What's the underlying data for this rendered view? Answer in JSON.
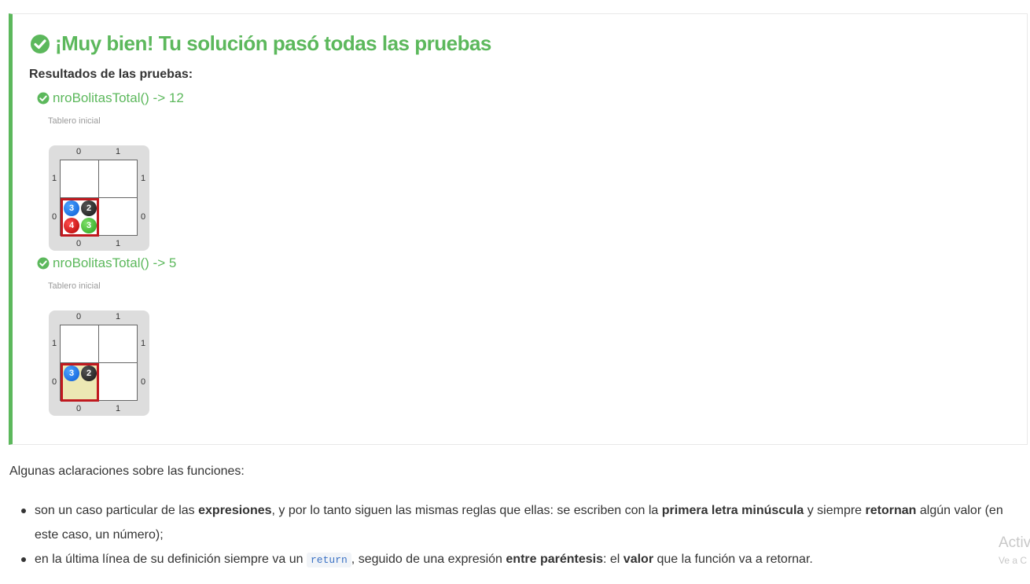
{
  "result": {
    "title": "¡Muy bien! Tu solución pasó todas las pruebas",
    "results_label": "Resultados de las pruebas:",
    "accent_color": "#5cb85c",
    "icon": "check-circle-icon",
    "tests": [
      {
        "title": "nroBolitasTotal() -> 12",
        "caption": "Tablero inicial",
        "board": {
          "columns": [
            "0",
            "1"
          ],
          "rows": [
            "1",
            "0"
          ],
          "head_cell": {
            "row": "0",
            "col": "0"
          },
          "balls": [
            "3",
            "2",
            "4",
            "3"
          ]
        }
      },
      {
        "title": "nroBolitasTotal() -> 5",
        "caption": "Tablero inicial",
        "board": {
          "columns": [
            "0",
            "1"
          ],
          "rows": [
            "1",
            "0"
          ],
          "head_cell": {
            "row": "0",
            "col": "0"
          },
          "balls": [
            "3",
            "2"
          ]
        }
      }
    ]
  },
  "explanation": {
    "intro": "Algunas aclaraciones sobre las funciones:",
    "bullet1": {
      "t1": "son un caso particular de las ",
      "b1": "expresiones",
      "t2": ", y por lo tanto siguen las mismas reglas que ellas: se escriben con la ",
      "b2": "primera letra minúscula",
      "t3": " y siempre ",
      "b3": "retornan",
      "t4": " algún valor (en este caso, un número);"
    },
    "bullet2": {
      "t1": "en la última línea de su definición siempre va un ",
      "code": "return",
      "t2": ", seguido de una expresión ",
      "b1": "entre paréntesis",
      "t3": ": el ",
      "b2": "valor",
      "t4": " que la función va a retornar."
    }
  },
  "watermark": {
    "line1": "Activ",
    "line2": "Ve a C"
  }
}
